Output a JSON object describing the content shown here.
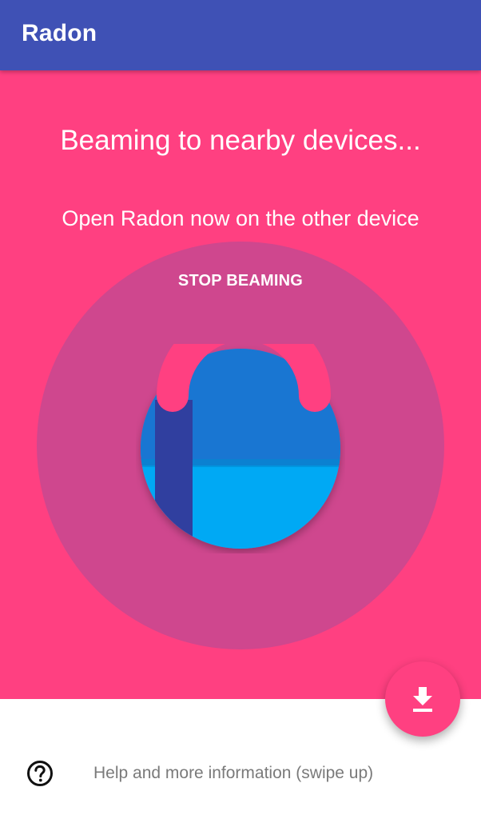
{
  "app_bar": {
    "title": "Radon",
    "color": "#3F51B5"
  },
  "main": {
    "background": "#FF4081",
    "status": "Beaming to nearby devices...",
    "instruction": "Open Radon now on the other device",
    "stop_button_label": "STOP BEAMING",
    "ring_color": "#CF478E",
    "logo_icon": "radon-logo-icon"
  },
  "fab": {
    "icon": "download-icon",
    "color": "#FF4081"
  },
  "footer": {
    "help_icon": "help-circle-icon",
    "help_text": "Help and more information (swipe up)"
  }
}
